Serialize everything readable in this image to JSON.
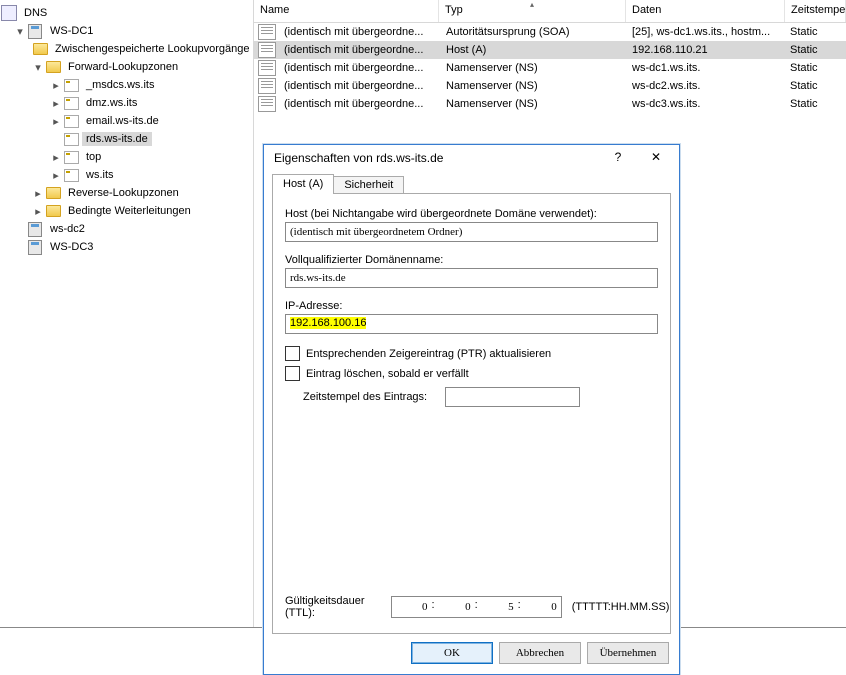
{
  "tree": {
    "root": "DNS",
    "nodes": [
      {
        "indent": 0,
        "exp": "▾",
        "icon": "srv",
        "label": "WS-DC1"
      },
      {
        "indent": 1,
        "exp": "",
        "icon": "fld",
        "label": "Zwischengespeicherte Lookupvorgänge"
      },
      {
        "indent": 1,
        "exp": "▾",
        "icon": "fld",
        "label": "Forward-Lookupzonen"
      },
      {
        "indent": 2,
        "exp": "▸",
        "icon": "zone",
        "label": "_msdcs.ws.its"
      },
      {
        "indent": 2,
        "exp": "▸",
        "icon": "zone",
        "label": "dmz.ws.its"
      },
      {
        "indent": 2,
        "exp": "▸",
        "icon": "zone",
        "label": "email.ws-its.de"
      },
      {
        "indent": 2,
        "exp": "",
        "icon": "zone",
        "label": "rds.ws-its.de",
        "sel": true
      },
      {
        "indent": 2,
        "exp": "▸",
        "icon": "zone",
        "label": "top"
      },
      {
        "indent": 2,
        "exp": "▸",
        "icon": "zone",
        "label": "ws.its"
      },
      {
        "indent": 1,
        "exp": "▸",
        "icon": "fld",
        "label": "Reverse-Lookupzonen"
      },
      {
        "indent": 1,
        "exp": "▸",
        "icon": "fld",
        "label": "Bedingte Weiterleitungen"
      },
      {
        "indent": 0,
        "exp": "",
        "icon": "srv",
        "label": "ws-dc2"
      },
      {
        "indent": 0,
        "exp": "",
        "icon": "srv",
        "label": "WS-DC3"
      }
    ]
  },
  "cols": {
    "name": "Name",
    "type": "Typ",
    "data": "Daten",
    "stamp": "Zeitstempel"
  },
  "rows": [
    {
      "name": "(identisch mit übergeordne...",
      "type": "Autoritätsursprung (SOA)",
      "data": "[25], ws-dc1.ws.its., hostm...",
      "stamp": "Static"
    },
    {
      "name": "(identisch mit übergeordne...",
      "type": "Host (A)",
      "data": "192.168.110.21",
      "stamp": "Static",
      "sel": true
    },
    {
      "name": "(identisch mit übergeordne...",
      "type": "Namenserver (NS)",
      "data": "ws-dc1.ws.its.",
      "stamp": "Static"
    },
    {
      "name": "(identisch mit übergeordne...",
      "type": "Namenserver (NS)",
      "data": "ws-dc2.ws.its.",
      "stamp": "Static"
    },
    {
      "name": "(identisch mit übergeordne...",
      "type": "Namenserver (NS)",
      "data": "ws-dc3.ws.its.",
      "stamp": "Static"
    }
  ],
  "dlg": {
    "title": "Eigenschaften von rds.ws-its.de",
    "tab1": "Host (A)",
    "tab2": "Sicherheit",
    "hostLbl": "Host (bei Nichtangabe wird übergeordnete Domäne verwendet):",
    "hostVal": "(identisch mit übergeordnetem Ordner)",
    "fqdnLbl": "Vollqualifizierter Domänenname:",
    "fqdnVal": "rds.ws-its.de",
    "ipLbl": "IP-Adresse:",
    "ipVal": "192.168.100.16",
    "chk1": "Entsprechenden Zeigereintrag (PTR) aktualisieren",
    "chk2": "Eintrag löschen, sobald er verfällt",
    "tsLbl": "Zeitstempel des Eintrags:",
    "ttlLbl": "Gültigkeitsdauer (TTL):",
    "ttl": {
      "d": "0",
      "h": "0",
      "m": "5",
      "s": "0"
    },
    "ttlFmt": "(TTTTT:HH.MM.SS)",
    "ok": "OK",
    "cancel": "Abbrechen",
    "apply": "Übernehmen"
  }
}
